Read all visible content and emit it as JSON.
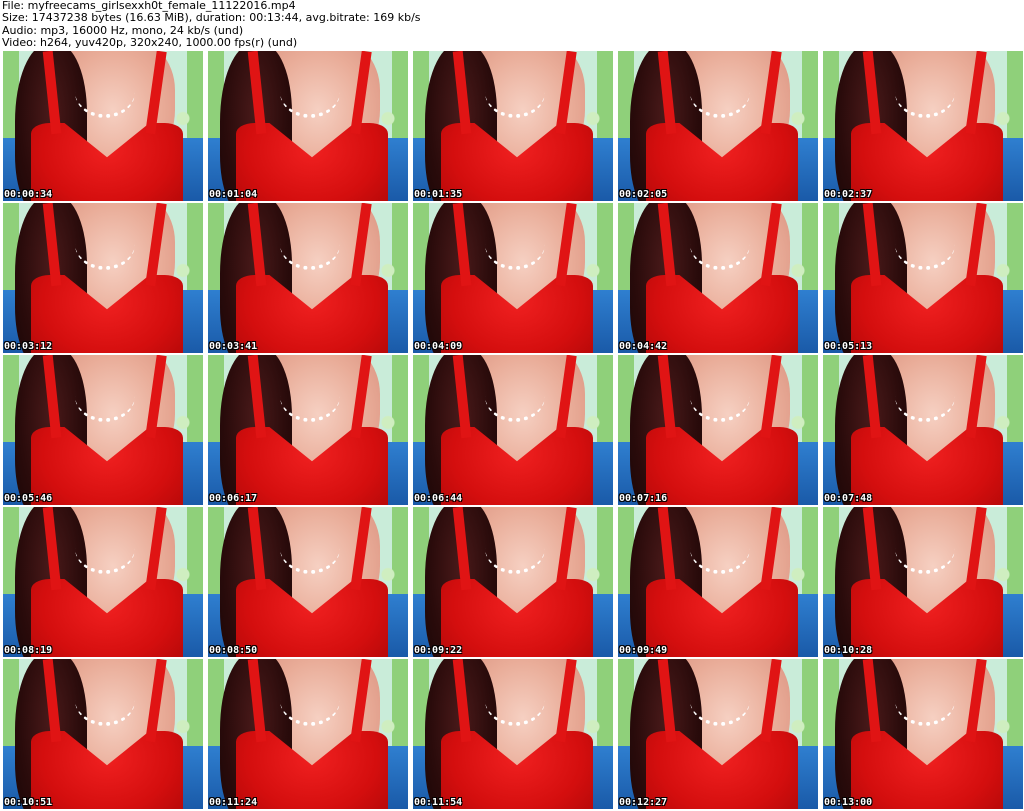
{
  "header": {
    "file_line": "File: myfreecams_girlsexxh0t_female_11122016.mp4",
    "size_line": "Size: 17437238 bytes (16.63 MiB), duration: 00:13:44, avg.bitrate: 169 kb/s",
    "audio_line": "Audio: mp3, 16000 Hz, mono, 24 kb/s (und)",
    "video_line": "Video: h264, yuv420p, 320x240, 1000.00 fps(r) (und)"
  },
  "thumbnails": [
    {
      "timestamp": "00:00:34"
    },
    {
      "timestamp": "00:01:04"
    },
    {
      "timestamp": "00:01:35"
    },
    {
      "timestamp": "00:02:05"
    },
    {
      "timestamp": "00:02:37"
    },
    {
      "timestamp": "00:03:12"
    },
    {
      "timestamp": "00:03:41"
    },
    {
      "timestamp": "00:04:09"
    },
    {
      "timestamp": "00:04:42"
    },
    {
      "timestamp": "00:05:13"
    },
    {
      "timestamp": "00:05:46"
    },
    {
      "timestamp": "00:06:17"
    },
    {
      "timestamp": "00:06:44"
    },
    {
      "timestamp": "00:07:16"
    },
    {
      "timestamp": "00:07:48"
    },
    {
      "timestamp": "00:08:19"
    },
    {
      "timestamp": "00:08:50"
    },
    {
      "timestamp": "00:09:22"
    },
    {
      "timestamp": "00:09:49"
    },
    {
      "timestamp": "00:10:28"
    },
    {
      "timestamp": "00:10:51"
    },
    {
      "timestamp": "00:11:24"
    },
    {
      "timestamp": "00:11:54"
    },
    {
      "timestamp": "00:12:27"
    },
    {
      "timestamp": "00:13:00"
    }
  ]
}
